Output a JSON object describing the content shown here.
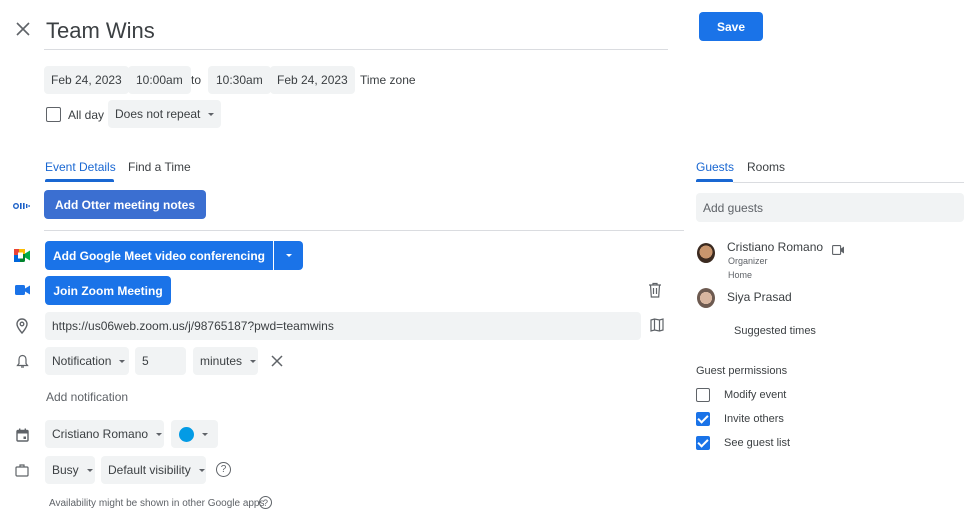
{
  "header": {
    "title": "Team Wins",
    "save_label": "Save"
  },
  "datetime": {
    "start_date": "Feb 24, 2023",
    "start_time": "10:00am",
    "to_label": "to",
    "end_time": "10:30am",
    "end_date": "Feb 24, 2023",
    "timezone_label": "Time zone",
    "all_day_label": "All day",
    "all_day_checked": false,
    "repeat": "Does not repeat"
  },
  "tabs": {
    "left": [
      {
        "label": "Event Details",
        "active": true
      },
      {
        "label": "Find a Time",
        "active": false
      }
    ],
    "right": [
      {
        "label": "Guests",
        "active": true
      },
      {
        "label": "Rooms",
        "active": false
      }
    ]
  },
  "conferencing": {
    "otter_label": "Add Otter meeting notes",
    "meet_label": "Add Google Meet video conferencing",
    "zoom_label": "Join Zoom Meeting"
  },
  "location": {
    "value": "https://us06web.zoom.us/j/98765187?pwd=teamwins"
  },
  "notification": {
    "type": "Notification",
    "amount": "5",
    "unit": "minutes",
    "add_label": "Add notification"
  },
  "calendar": {
    "owner": "Cristiano Romano",
    "color": "#039be5"
  },
  "availability": {
    "status": "Busy",
    "visibility": "Default visibility",
    "note": "Availability might be shown in other Google apps"
  },
  "guests": {
    "add_placeholder": "Add guests",
    "list": [
      {
        "name": "Cristiano Romano",
        "role": "Organizer",
        "location": "Home"
      },
      {
        "name": "Siya Prasad"
      }
    ],
    "suggested_times_label": "Suggested times"
  },
  "permissions": {
    "title": "Guest permissions",
    "items": [
      {
        "label": "Modify event",
        "checked": false
      },
      {
        "label": "Invite others",
        "checked": true
      },
      {
        "label": "See guest list",
        "checked": true
      }
    ]
  },
  "colors": {
    "accent": "#1a73e8",
    "tab_active": "#1967d2",
    "otter_button": "#3b6fd1",
    "chip_bg": "#f1f3f4"
  }
}
